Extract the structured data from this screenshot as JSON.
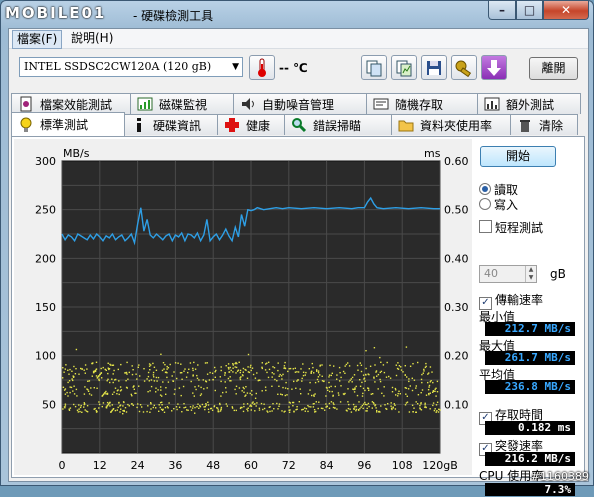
{
  "app": {
    "logo": "MOBILE01",
    "title": "- 硬碟檢測工具"
  },
  "window_buttons": {
    "minimize": "–",
    "maximize": "□",
    "close": "✕"
  },
  "menu": [
    {
      "label": "檔案(F)"
    },
    {
      "label": "說明(H)"
    }
  ],
  "toolbar": {
    "drive": "INTEL SSDSC2CW120A (120 gB)",
    "temperature": "-- ℃",
    "exit_label": "離開"
  },
  "tabs_row1": [
    {
      "label": "檔案效能測試",
      "icon": "file-benchmark-icon"
    },
    {
      "label": "磁碟監視",
      "icon": "disk-monitor-icon"
    },
    {
      "label": "自動噪音管理",
      "icon": "speaker-icon"
    },
    {
      "label": "隨機存取",
      "icon": "random-access-icon"
    },
    {
      "label": "額外測試",
      "icon": "extra-tests-icon"
    }
  ],
  "tabs_row2": [
    {
      "label": "標準測試",
      "icon": "lightbulb-icon"
    },
    {
      "label": "硬碟資訊",
      "icon": "info-icon"
    },
    {
      "label": "健康",
      "icon": "health-cross-icon"
    },
    {
      "label": "錯誤掃瞄",
      "icon": "magnifier-icon"
    },
    {
      "label": "資料夾使用率",
      "icon": "folder-icon"
    },
    {
      "label": "清除",
      "icon": "trash-icon"
    }
  ],
  "right_panel": {
    "start": "開始",
    "read": "讀取",
    "write": "寫入",
    "short_test": "短程測試",
    "short_test_value": "40",
    "short_test_unit": "gB",
    "transfer_rate": "傳輸速率",
    "min_label": "最小值",
    "min_value": "212.7 MB/s",
    "max_label": "最大值",
    "max_value": "261.7 MB/s",
    "avg_label": "平均值",
    "avg_value": "236.8 MB/s",
    "access_time": "存取時間",
    "access_value": "0.182 ms",
    "burst_rate": "突發速率",
    "burst_value": "216.2 MB/s",
    "cpu_label": "CPU 使用率",
    "cpu_value": "7.3%"
  },
  "watermark": "#1160389",
  "colors": {
    "transfer": "#2e9fe6",
    "access": "#e6e64a",
    "chart_bg": "#2a2a2a",
    "grid": "#4a4a4a"
  },
  "chart_data": {
    "type": "scatter",
    "y_left_label": "MB/s",
    "y_right_label": "ms",
    "x_unit": "gB",
    "x_ticks": [
      "0",
      "12",
      "24",
      "36",
      "48",
      "60",
      "72",
      "84",
      "96",
      "108",
      "120"
    ],
    "y_left_ticks": [
      "300",
      "250",
      "200",
      "150",
      "100",
      "50"
    ],
    "y_right_ticks": [
      "0.60",
      "0.50",
      "0.40",
      "0.30",
      "0.20",
      "0.10"
    ],
    "xlim": [
      0,
      120
    ],
    "ylim_left": [
      0,
      300
    ],
    "ylim_right": [
      0,
      0.6
    ],
    "transfer_series": {
      "name": "Transfer rate",
      "x": [
        0,
        1,
        2,
        3,
        4,
        5,
        6,
        7,
        8,
        9,
        10,
        11,
        12,
        13,
        14,
        15,
        16,
        17,
        18,
        19,
        20,
        21,
        22,
        23,
        24,
        25,
        26,
        27,
        28,
        29,
        30,
        31,
        32,
        33,
        34,
        35,
        36,
        37,
        38,
        39,
        40,
        41,
        42,
        43,
        44,
        45,
        46,
        47,
        48,
        49,
        50,
        51,
        52,
        53,
        54,
        55,
        56,
        57,
        58,
        59,
        60,
        61,
        62,
        63,
        64,
        66,
        68,
        70,
        72,
        76,
        80,
        84,
        88,
        92,
        94,
        96,
        97,
        98,
        99,
        100,
        102,
        106,
        110,
        114,
        118,
        120
      ],
      "y": [
        225,
        219,
        224,
        222,
        218,
        225,
        223,
        221,
        219,
        224,
        220,
        225,
        222,
        218,
        223,
        221,
        225,
        219,
        222,
        224,
        218,
        221,
        225,
        216,
        235,
        252,
        228,
        240,
        224,
        221,
        225,
        222,
        219,
        223,
        225,
        218,
        224,
        222,
        226,
        218,
        225,
        224,
        221,
        226,
        218,
        224,
        240,
        218,
        222,
        225,
        219,
        224,
        230,
        223,
        218,
        232,
        222,
        245,
        233,
        250,
        249,
        250,
        252,
        251,
        250,
        251,
        252,
        251,
        252,
        251,
        252,
        251,
        252,
        251,
        252,
        252,
        258,
        262,
        256,
        252,
        251,
        252,
        251,
        252,
        251,
        251
      ]
    },
    "access_series": {
      "name": "Access time",
      "bands_ms": [
        0.177,
        0.157,
        0.129,
        0.096
      ]
    }
  }
}
